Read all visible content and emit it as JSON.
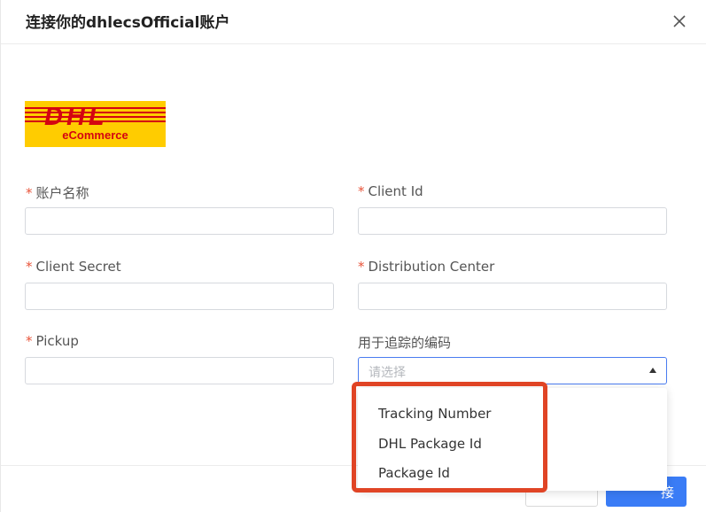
{
  "dialog": {
    "title": "连接你的dhlecsOfficial账户",
    "close_icon": "close-icon"
  },
  "logo": {
    "brand": "DHL",
    "subtitle": "eCommerce",
    "colors": {
      "background": "#ffcc00",
      "brand_red": "#d40511"
    }
  },
  "form": {
    "required_mark": "*",
    "account_name": {
      "label": "账户名称",
      "value": ""
    },
    "client_id": {
      "label": "Client Id",
      "value": ""
    },
    "client_secret": {
      "label": "Client Secret",
      "value": ""
    },
    "distribution_center": {
      "label": "Distribution Center",
      "value": ""
    },
    "pickup": {
      "label": "Pickup",
      "value": ""
    },
    "tracking_code": {
      "label": "用于追踪的编码",
      "placeholder": "请选择",
      "expanded": true
    }
  },
  "dropdown": {
    "options": [
      "Tracking Number",
      "DHL Package Id",
      "Package Id"
    ]
  },
  "footer": {
    "connect_label_visible": "接"
  },
  "colors": {
    "accent": "#3a7cf6",
    "required": "#e8543a",
    "highlight": "#e04425"
  }
}
